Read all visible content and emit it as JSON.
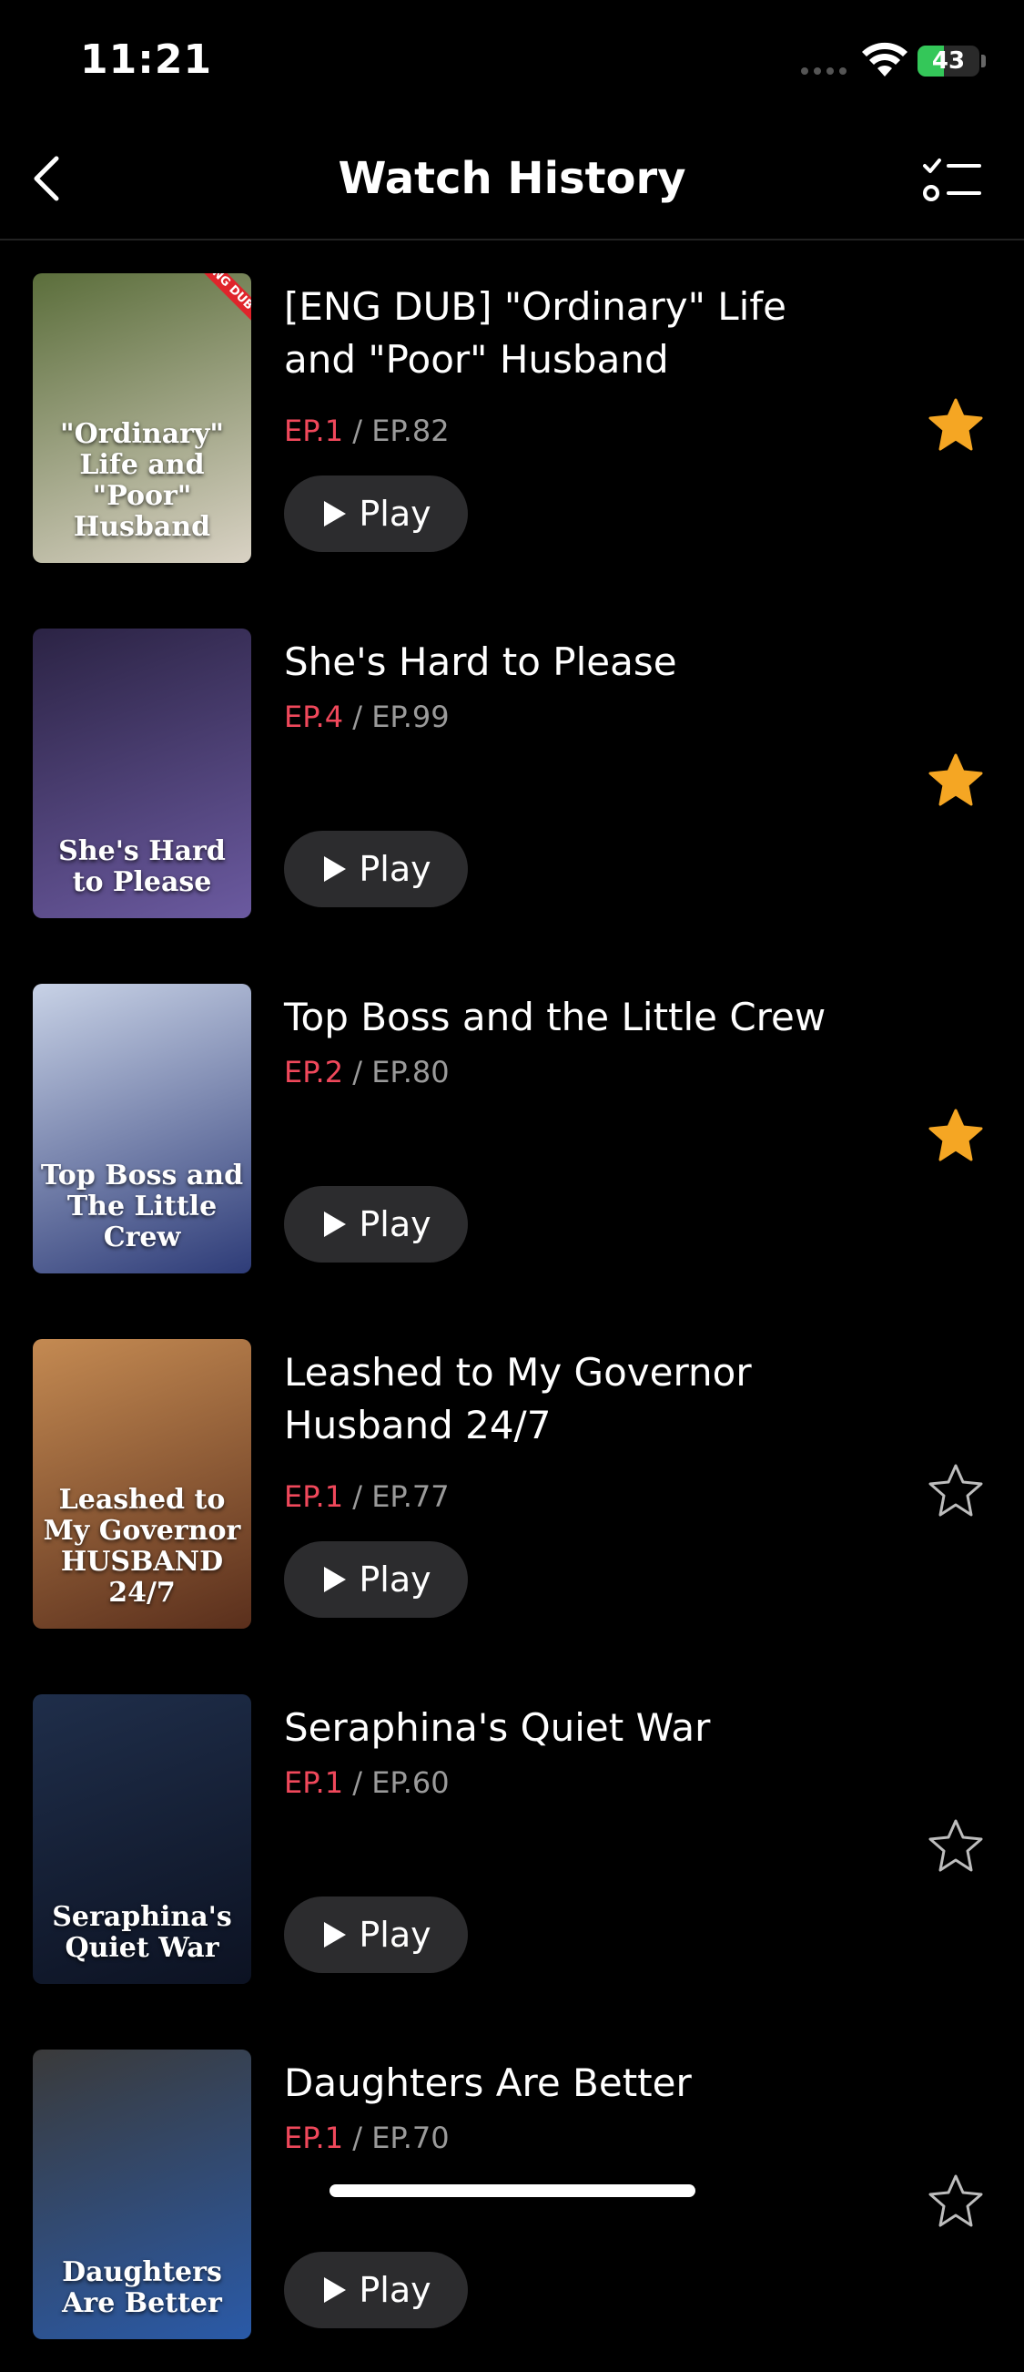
{
  "status_bar": {
    "time": "11:21",
    "battery": "43",
    "battery_level": 0.43
  },
  "header": {
    "title": "Watch History",
    "back_icon": "chevron-left-icon",
    "manage_icon": "checklist-icon"
  },
  "play_label": "Play",
  "items": [
    {
      "title": "[ENG DUB] \"Ordinary\" Life and \"Poor\" Husband",
      "current_ep": "EP.1",
      "total_ep": "/ EP.82",
      "favorited": true,
      "poster_caption": "\"Ordinary\" Life and \"Poor\" Husband",
      "badge": "ENG DUB",
      "colors": [
        "#5b6e3b",
        "#d9d2c4"
      ]
    },
    {
      "title": "She's Hard to Please",
      "current_ep": "EP.4",
      "total_ep": "/ EP.99",
      "favorited": true,
      "poster_caption": "She's Hard to Please",
      "badge": "",
      "colors": [
        "#2b2344",
        "#6b5aa0"
      ]
    },
    {
      "title": "Top Boss and the Little Crew",
      "current_ep": "EP.2",
      "total_ep": "/ EP.80",
      "favorited": true,
      "poster_caption": "Top Boss and The Little Crew",
      "badge": "",
      "colors": [
        "#c8d2e6",
        "#2e3c78"
      ]
    },
    {
      "title": "Leashed to My Governor Husband 24/7",
      "current_ep": "EP.1",
      "total_ep": "/ EP.77",
      "favorited": false,
      "poster_caption": "Leashed to My Governor HUSBAND 24/7",
      "badge": "",
      "colors": [
        "#c48a52",
        "#5a2f1c"
      ]
    },
    {
      "title": "Seraphina's Quiet War",
      "current_ep": "EP.1",
      "total_ep": "/ EP.60",
      "favorited": false,
      "poster_caption": "Seraphina's Quiet War",
      "badge": "",
      "colors": [
        "#1f2e4a",
        "#0c1222"
      ]
    },
    {
      "title": "Daughters Are Better",
      "current_ep": "EP.1",
      "total_ep": "/ EP.70",
      "favorited": false,
      "poster_caption": "Daughters Are Better",
      "badge": "",
      "colors": [
        "#3a3a3a",
        "#2a5aa8"
      ]
    }
  ],
  "colors": {
    "accent": "#f0485b",
    "star": "#f5a623",
    "button_bg": "#2c2c2e"
  }
}
